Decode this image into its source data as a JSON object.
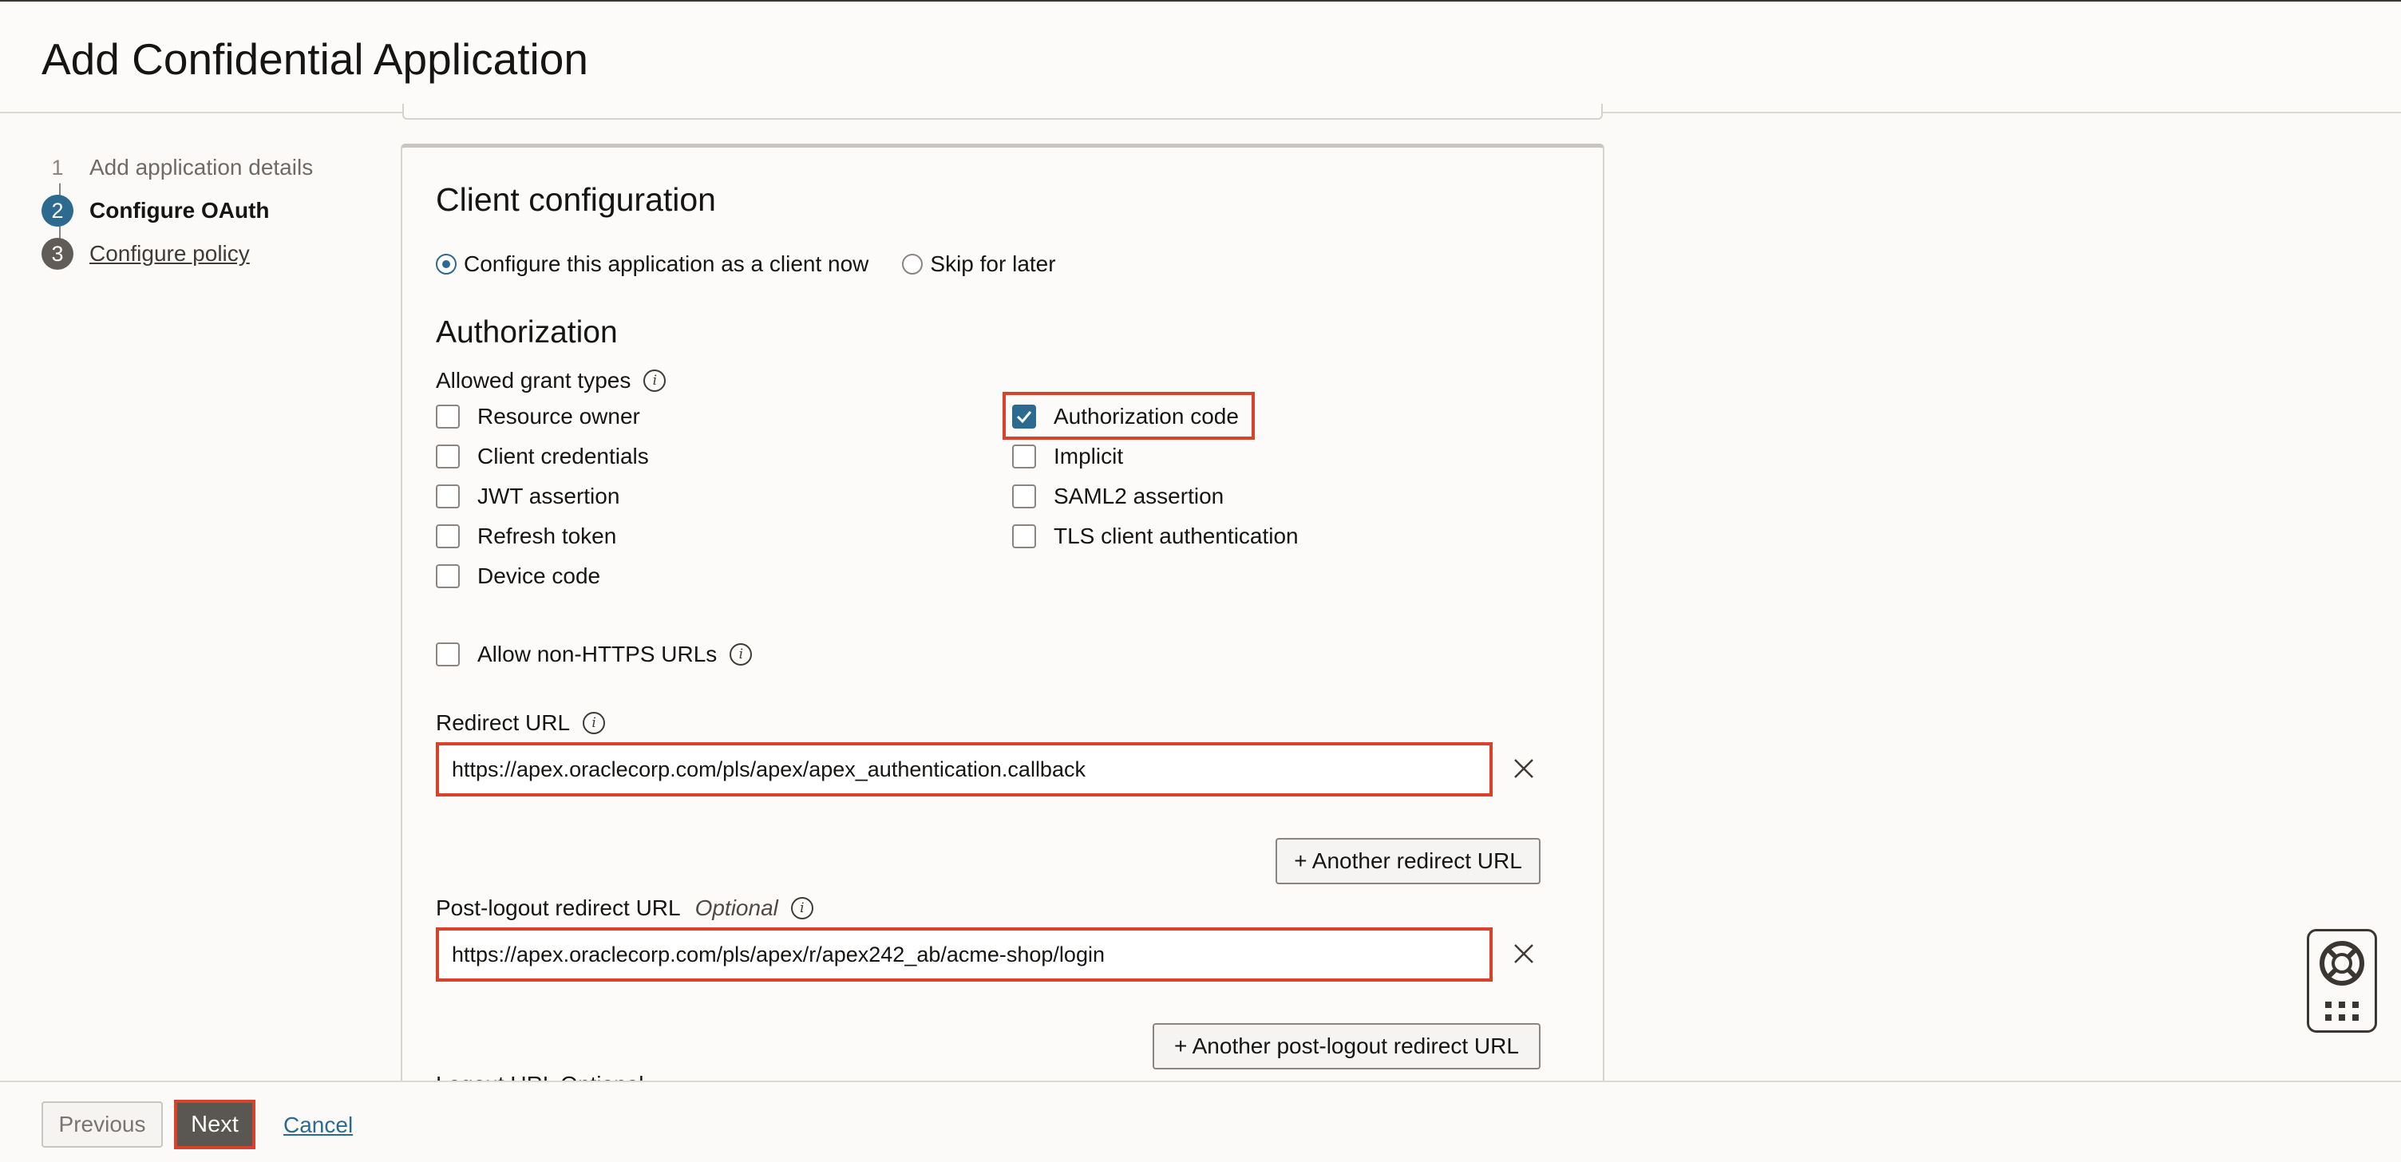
{
  "header": {
    "title": "Add Confidential Application"
  },
  "steps": [
    {
      "number": "1",
      "label": "Add application details"
    },
    {
      "number": "2",
      "label": "Configure OAuth"
    },
    {
      "number": "3",
      "label": "Configure policy"
    }
  ],
  "client_config": {
    "title": "Client configuration",
    "radio_now": "Configure this application as a client now",
    "radio_skip": "Skip for later",
    "selected": "Configure this application as a client now"
  },
  "authorization": {
    "title": "Authorization",
    "grant_types_label": "Allowed grant types",
    "grants_left": [
      {
        "label": "Resource owner",
        "checked": false
      },
      {
        "label": "Client credentials",
        "checked": false
      },
      {
        "label": "JWT assertion",
        "checked": false
      },
      {
        "label": "Refresh token",
        "checked": false
      },
      {
        "label": "Device code",
        "checked": false
      }
    ],
    "grants_right": [
      {
        "label": "Authorization code",
        "checked": true
      },
      {
        "label": "Implicit",
        "checked": false
      },
      {
        "label": "SAML2 assertion",
        "checked": false
      },
      {
        "label": "TLS client authentication",
        "checked": false
      }
    ],
    "allow_non_https": "Allow non-HTTPS URLs",
    "redirect_label": "Redirect URL",
    "redirect_value": "https://apex.oraclecorp.com/pls/apex/apex_authentication.callback",
    "another_redirect": "+ Another redirect URL",
    "post_logout_label": "Post-logout redirect URL",
    "optional": "Optional",
    "post_logout_value": "https://apex.oraclecorp.com/pls/apex/r/apex242_ab/acme-shop/login",
    "another_post_logout": "+ Another post-logout redirect URL",
    "logout_label_partial": "Logout URL  Optional"
  },
  "footer": {
    "previous": "Previous",
    "next": "Next",
    "cancel": "Cancel"
  },
  "colors": {
    "accent": "#2c6a8f",
    "highlight": "#d9412a",
    "next_button": "#5a5651"
  },
  "icons": [
    "info-icon",
    "close-icon",
    "check-icon",
    "help-lifebuoy-icon",
    "apps-grid-icon"
  ]
}
